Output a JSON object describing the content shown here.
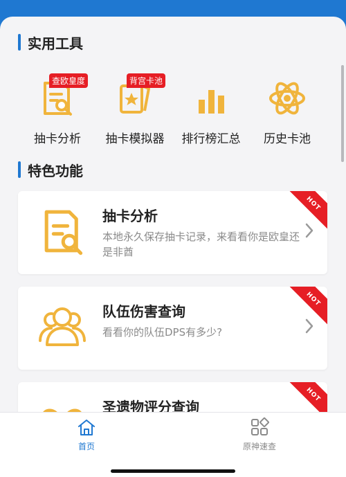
{
  "colors": {
    "accent": "#1f78d1",
    "icon": "#f0b43c",
    "hot": "#e61e25"
  },
  "tools_section": {
    "title": "实用工具",
    "items": [
      {
        "label": "抽卡分析",
        "badge": "查欧皇度",
        "icon": "document-search-icon"
      },
      {
        "label": "抽卡模拟器",
        "badge": "背宫卡池",
        "icon": "card-star-icon"
      },
      {
        "label": "排行榜汇总",
        "badge": "",
        "icon": "bar-chart-icon"
      },
      {
        "label": "历史卡池",
        "badge": "",
        "icon": "atom-icon"
      }
    ]
  },
  "features_section": {
    "title": "特色功能",
    "cards": [
      {
        "title": "抽卡分析",
        "desc": "本地永久保存抽卡记录，来看看你是欧皇还是非酋",
        "hot": "HOT",
        "icon": "document-search-icon"
      },
      {
        "title": "队伍伤害查询",
        "desc": "看看你的队伍DPS有多少?",
        "hot": "HOT",
        "icon": "group-icon"
      },
      {
        "title": "圣遗物评分查询",
        "desc": "",
        "hot": "HOT",
        "icon": "butterfly-icon"
      }
    ]
  },
  "tabbar": {
    "tabs": [
      {
        "label": "首页",
        "icon": "home-icon",
        "active": true
      },
      {
        "label": "原神速查",
        "icon": "grid-icon",
        "active": false
      }
    ]
  }
}
